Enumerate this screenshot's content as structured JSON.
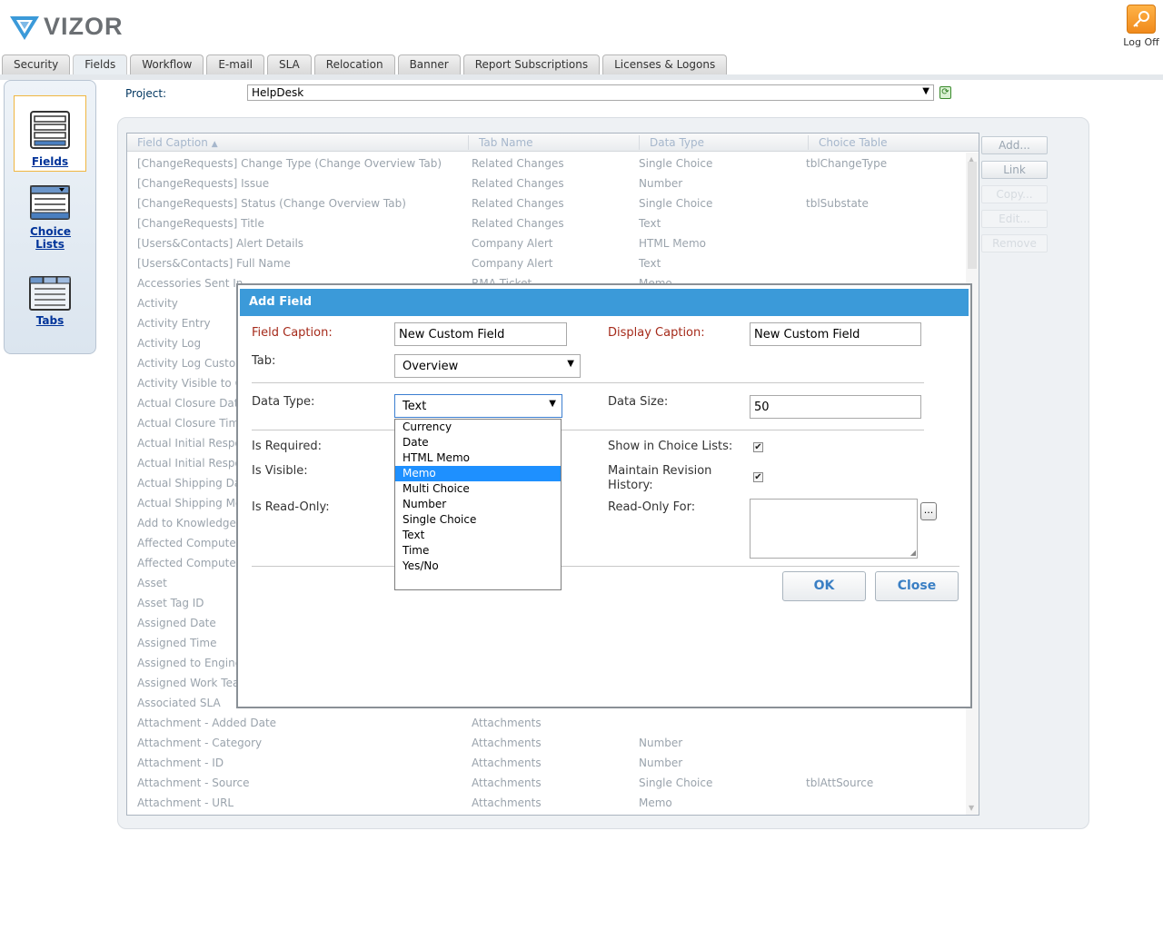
{
  "brand": {
    "name": "VIZOR",
    "accent": "#3b9ad9"
  },
  "header": {
    "logoff_label": "Log Off"
  },
  "tabs": [
    {
      "label": "Security",
      "active": false
    },
    {
      "label": "Fields",
      "active": true
    },
    {
      "label": "Workflow",
      "active": false
    },
    {
      "label": "E-mail",
      "active": false
    },
    {
      "label": "SLA",
      "active": false
    },
    {
      "label": "Relocation",
      "active": false
    },
    {
      "label": "Banner",
      "active": false
    },
    {
      "label": "Report Subscriptions",
      "active": false
    },
    {
      "label": "Licenses & Logons",
      "active": false
    }
  ],
  "leftnav": [
    {
      "label": "Fields",
      "icon": "fields-icon",
      "selected": true
    },
    {
      "label": "Choice Lists",
      "icon": "choice-lists-icon",
      "selected": false
    },
    {
      "label": "Tabs",
      "icon": "tabs-icon",
      "selected": false
    }
  ],
  "project": {
    "label": "Project:",
    "value": "HelpDesk"
  },
  "grid": {
    "columns": [
      "Field Caption",
      "Tab Name",
      "Data Type",
      "Choice Table"
    ],
    "sort_indicator": "▲",
    "rows_top": [
      [
        "[ChangeRequests] Change Type (Change Overview Tab)",
        "Related Changes",
        "Single Choice",
        "tblChangeType"
      ],
      [
        "[ChangeRequests] Issue",
        "Related Changes",
        "Number",
        ""
      ],
      [
        "[ChangeRequests] Status (Change Overview Tab)",
        "Related Changes",
        "Single Choice",
        "tblSubstate"
      ],
      [
        "[ChangeRequests] Title",
        "Related Changes",
        "Text",
        ""
      ],
      [
        "[Users&Contacts] Alert Details",
        "Company Alert",
        "HTML Memo",
        ""
      ],
      [
        "[Users&Contacts] Full Name",
        "Company Alert",
        "Text",
        ""
      ],
      [
        "Accessories Sent In",
        "RMA Ticket",
        "Memo",
        ""
      ]
    ],
    "rows_left": [
      "Activity",
      "Activity Entry",
      "Activity Log",
      "Activity Log Custome",
      "Activity Visible to Cu",
      "Actual Closure Date",
      "Actual Closure Time",
      "Actual Initial Respon",
      "Actual Initial Respon",
      "Actual Shipping Date",
      "Actual Shipping Meth",
      "Add to Knowledge Ba",
      "Affected Computer",
      "Affected Computer (",
      "Asset",
      "Asset Tag ID",
      "Assigned Date",
      "Assigned Time",
      "Assigned to Enginee",
      "Assigned Work Team",
      "Associated SLA"
    ],
    "rows_bottom": [
      [
        "Attachment - Added Date",
        "Attachments",
        "",
        ""
      ],
      [
        "Attachment - Category",
        "Attachments",
        "Number",
        ""
      ],
      [
        "Attachment - ID",
        "Attachments",
        "Number",
        ""
      ],
      [
        "Attachment - Source",
        "Attachments",
        "Single Choice",
        "tblAttSource"
      ],
      [
        "Attachment - URL",
        "Attachments",
        "Memo",
        ""
      ]
    ]
  },
  "side_buttons": [
    {
      "label": "Add...",
      "enabled": true
    },
    {
      "label": "Link",
      "enabled": true
    },
    {
      "label": "Copy...",
      "enabled": false
    },
    {
      "label": "Edit...",
      "enabled": false
    },
    {
      "label": "Remove",
      "enabled": false
    }
  ],
  "dialog": {
    "title": "Add Field",
    "field_caption_label": "Field Caption:",
    "field_caption_value": "New Custom Field",
    "display_caption_label": "Display Caption:",
    "display_caption_value": "New Custom Field",
    "tab_label": "Tab:",
    "tab_value": "Overview",
    "data_type_label": "Data Type:",
    "data_type_value": "Text",
    "data_size_label": "Data Size:",
    "data_size_value": "50",
    "is_required_label": "Is Required:",
    "is_visible_label": "Is Visible:",
    "is_readonly_label": "Is Read-Only:",
    "show_choice_label": "Show in Choice Lists:",
    "show_choice_checked": true,
    "maintain_rev_label_1": "Maintain Revision",
    "maintain_rev_label_2": "History:",
    "maintain_rev_checked": true,
    "readonly_for_label": "Read-Only For:",
    "ellipsis": "...",
    "ok_label": "OK",
    "close_label": "Close",
    "data_type_options": [
      "Currency",
      "Date",
      "HTML Memo",
      "Memo",
      "Multi Choice",
      "Number",
      "Single Choice",
      "Text",
      "Time",
      "Yes/No"
    ],
    "highlighted_option": "Memo"
  }
}
